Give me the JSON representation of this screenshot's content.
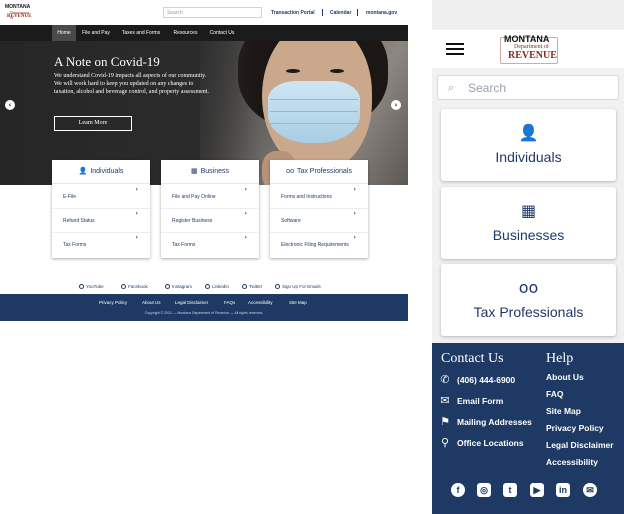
{
  "desktop": {
    "logo": {
      "line1": "MONTANA",
      "line2": "Department of",
      "line3": "REVENUE"
    },
    "search_placeholder": "Search",
    "top_links": [
      "Transaction Portal",
      "Calendar",
      "montana.gov"
    ],
    "nav": [
      "Home",
      "File and Pay",
      "Taxes and Forms",
      "Resources",
      "Contact Us"
    ],
    "hero": {
      "title": "A Note on Covid-19",
      "body": "We understand Covid-19 impacts all aspects of our community. We will work hard to keep you updated on any changes to taxation, alcohol and beverage control, and property assessment.",
      "button": "Learn More"
    },
    "cards": [
      {
        "icon": "person-icon",
        "title": "Individuals",
        "links": [
          "E-File",
          "Refund Status",
          "Tax Forms"
        ]
      },
      {
        "icon": "building-icon",
        "title": "Business",
        "links": [
          "File and Pay Online",
          "Register Business",
          "Tax Forms"
        ]
      },
      {
        "icon": "glasses-icon",
        "title": "Tax Professionals",
        "links": [
          "Forms and Instructions",
          "Software",
          "Electronic Filing Requirements"
        ]
      }
    ],
    "social": [
      "YouTube",
      "Facebook",
      "Instagram",
      "LinkedIn",
      "Twitter",
      "Sign Up For Emails"
    ],
    "footer_links": [
      "Privacy Policy",
      "About Us",
      "Legal Disclaimer",
      "FAQs",
      "Accessibility",
      "Site Map"
    ],
    "copyright": "Copyright © 2021 — Montana Department of Revenue — All rights reserved."
  },
  "mobile": {
    "logo": {
      "line1": "MONTANA",
      "line2": "Department of",
      "line3": "REVENUE"
    },
    "search_placeholder": "Search",
    "cards": [
      {
        "icon": "person-icon",
        "title": "Individuals"
      },
      {
        "icon": "building-icon",
        "title": "Businesses"
      },
      {
        "icon": "glasses-icon",
        "title": "Tax Professionals"
      }
    ],
    "contact": {
      "heading": "Contact Us",
      "items": [
        {
          "icon": "phone-icon",
          "label": "(406) 444-6900"
        },
        {
          "icon": "email-icon",
          "label": "Email Form"
        },
        {
          "icon": "flag-icon",
          "label": "Mailing Addresses"
        },
        {
          "icon": "location-pin-icon",
          "label": "Office Locations"
        }
      ]
    },
    "help": {
      "heading": "Help",
      "items": [
        "About Us",
        "FAQ",
        "Site Map",
        "Privacy Policy",
        "Legal Disclaimer",
        "Accessibility"
      ]
    },
    "social_icons": [
      "facebook-icon",
      "instagram-icon",
      "twitter-icon",
      "youtube-icon",
      "linkedin-icon",
      "email-signup-icon"
    ]
  },
  "colors": {
    "brand_navy": "#1e3a64",
    "link_blue": "#1f3a68",
    "logo_red": "#8a2b1a"
  }
}
